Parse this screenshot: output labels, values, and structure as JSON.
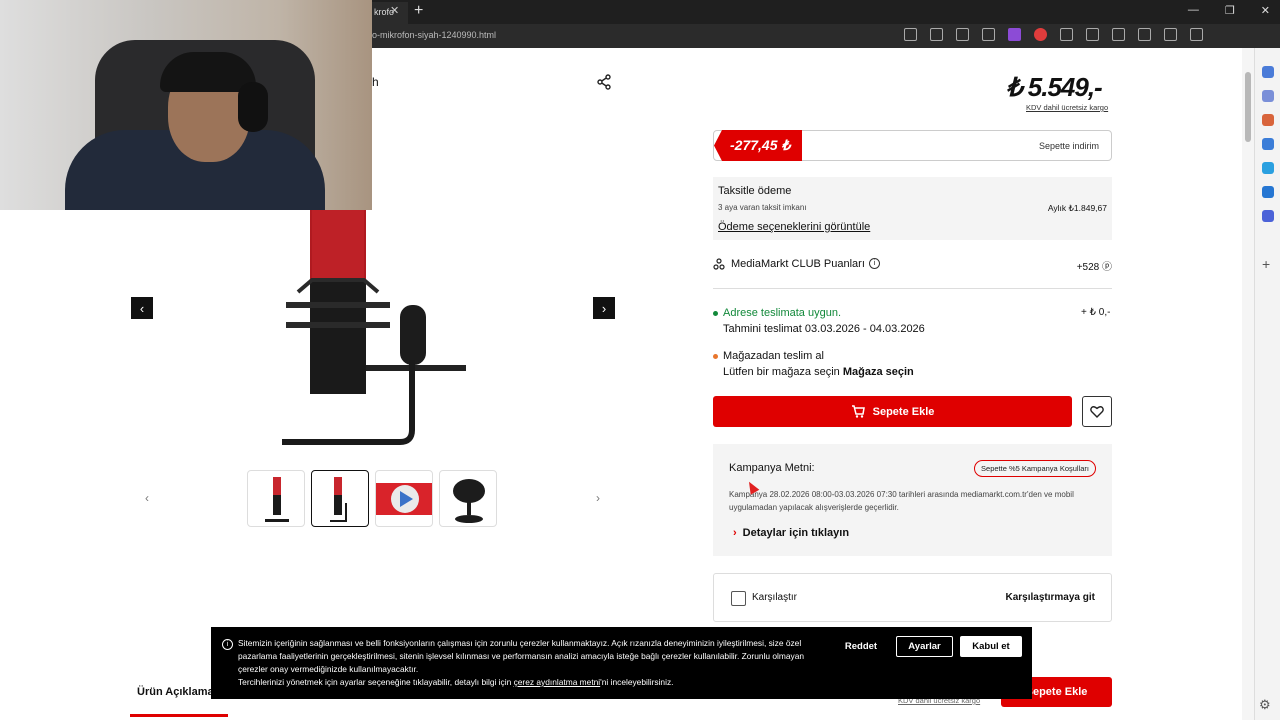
{
  "browser": {
    "tab_title": "krofo",
    "tab_close": "✕",
    "new_tab": "+",
    "url": "o-mikrofon-siyah-1240990.html",
    "window_controls": [
      "—",
      "❐",
      "✕"
    ]
  },
  "gallery": {
    "breadcrumb_tail": "h",
    "prev_arrow": "‹",
    "next_arrow": "›",
    "thumb_prev": "‹",
    "thumb_next": "›"
  },
  "pricing": {
    "price": "₺ 5.549,-",
    "price_note": "KDV dahil ücretsiz kargo",
    "discount_amount": "-277,45 ₺",
    "discount_label": "Sepette indirim"
  },
  "installment": {
    "title": "Taksitle ödeme",
    "subtitle": "3 aya varan taksit imkanı",
    "monthly": "Aylık ₺1.849,67",
    "link": "Ödeme seçeneklerini görüntüle"
  },
  "club": {
    "label": "MediaMarkt CLUB Puanları",
    "info": "i",
    "points": "+528 ⓟ"
  },
  "delivery": {
    "home_status": "Adrese teslimata uygun.",
    "home_estimate": "Tahmini teslimat 03.03.2026 - 04.03.2026",
    "home_price": "+ ₺ 0,-",
    "store_title": "Mağazadan teslim al",
    "store_prompt": "Lütfen bir mağaza seçin",
    "store_link": "Mağaza seçin"
  },
  "actions": {
    "add_to_cart": "Sepete Ekle",
    "cart_icon": "🛒"
  },
  "campaign": {
    "title": "Kampanya Metni:",
    "badge": "Sepette %5 Kampanya Koşulları",
    "text": "Kampanya 28.02.2026 08:00-03.03.2026 07:30 tarihleri arasında mediamarkt.com.tr'den ve mobil uygulamadan yapılacak alışverişlerde geçerlidir.",
    "details_link": "Detaylar için tıklayın",
    "chevron": "›"
  },
  "compare": {
    "label": "Karşılaştır",
    "link": "Karşılaştırmaya git"
  },
  "cookie": {
    "info": "i",
    "line1": "Sitemizin içeriğinin sağlanması ve belli fonksiyonların çalışması için zorunlu çerezler kullanmaktayız. Açık rızanızla deneyiminizin iyileştirilmesi, size özel pazarlama faaliyetlerinin gerçekleştirilmesi, sitenin işlevsel kılınması ve performansın analizi amacıyla isteğe bağlı çerezler kullanılabilir. Zorunlu olmayan çerezler onay vermediğinizde kullanılmayacaktır.",
    "line2_pre": "Tercihlerinizi yönetmek için ayarlar seçeneğine tıklayabilir, detaylı bilgi için",
    "line2_link": "çerez aydınlatma metni",
    "line2_post": "'ni inceleyebilirsiniz.",
    "reject": "Reddet",
    "settings": "Ayarlar",
    "accept": "Kabul et"
  },
  "bottom": {
    "tab_label": "Ürün Açıklama",
    "note": "KDV dahil ücretsiz kargo",
    "cart": "Sepete Ekle",
    "gear": "⚙"
  },
  "colors": {
    "brand_red": "#df0000",
    "available_green": "#12893a"
  }
}
